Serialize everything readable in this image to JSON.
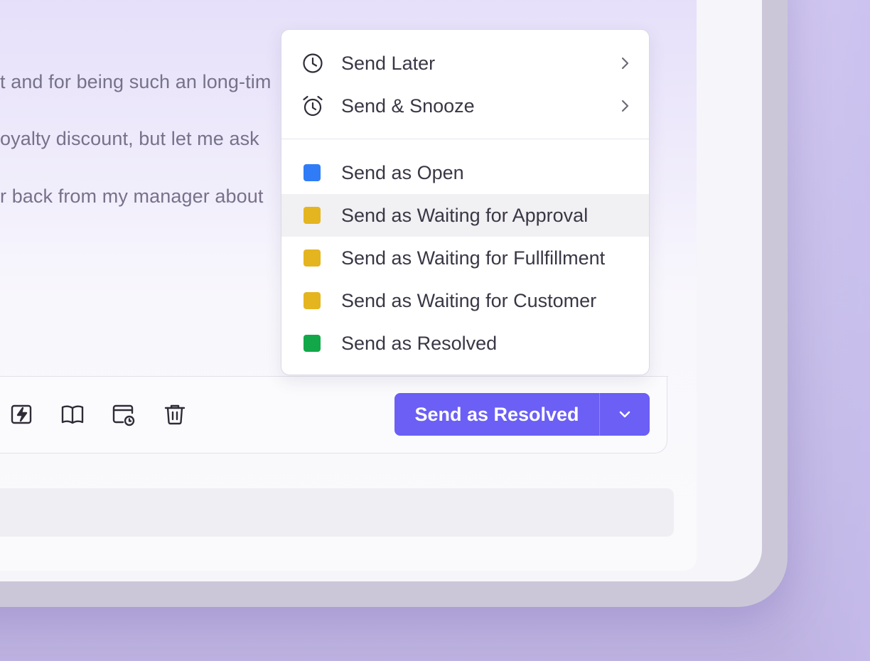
{
  "message": {
    "lines": [
      "t and for being such an long-tim",
      "oyalty discount, but let me ask",
      "r back from my manager about"
    ]
  },
  "menu": {
    "schedule_items": [
      {
        "label": "Send Later",
        "icon": "clock-icon"
      },
      {
        "label": "Send & Snooze",
        "icon": "alarm-clock-icon"
      }
    ],
    "status_items": [
      {
        "label": "Send as Open",
        "color": "#2f7cf6"
      },
      {
        "label": "Send as Waiting for Approval",
        "color": "#e5b520",
        "highlighted": true
      },
      {
        "label": "Send as Waiting for Fullfillment",
        "color": "#e5b520"
      },
      {
        "label": "Send as Waiting for Customer",
        "color": "#e5b520"
      },
      {
        "label": "Send as Resolved",
        "color": "#12a84a"
      }
    ]
  },
  "toolbar": {
    "icons": [
      "macro-bolt-icon",
      "knowledge-book-icon",
      "schedule-calendar-icon",
      "trash-icon"
    ]
  },
  "send_button": {
    "label": "Send as Resolved",
    "color": "#6b5ff5"
  }
}
